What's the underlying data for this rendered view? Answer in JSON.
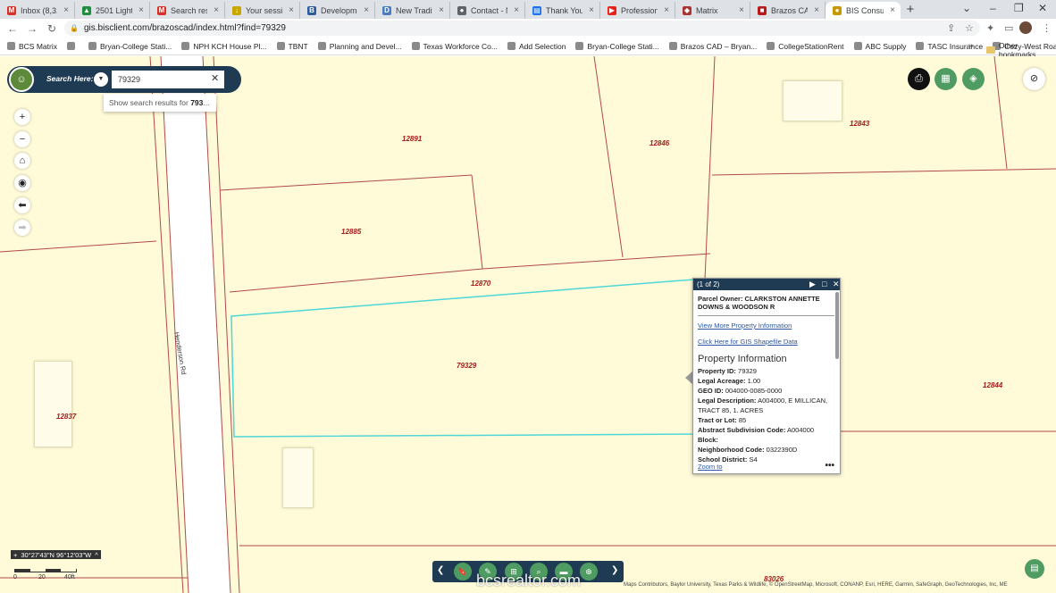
{
  "browser": {
    "tabs": [
      {
        "label": "Inbox (8,310)",
        "icon": "gmail-icon",
        "color": "#d93025",
        "glyph": "M"
      },
      {
        "label": "2501 Lightfoo",
        "icon": "drive-icon",
        "color": "#1e8e3e",
        "glyph": "▲"
      },
      {
        "label": "Search results",
        "icon": "gmail-icon",
        "color": "#d93025",
        "glyph": "M"
      },
      {
        "label": "Your session",
        "icon": "download-icon",
        "color": "#c9a600",
        "glyph": "↓"
      },
      {
        "label": "Development",
        "icon": "b-icon",
        "color": "#2d5a9b",
        "glyph": "B"
      },
      {
        "label": "New Traditio",
        "icon": "doc-icon",
        "color": "#4a7bc0",
        "glyph": "D"
      },
      {
        "label": "Contact - Ne",
        "icon": "globe-icon",
        "color": "#5f6368",
        "glyph": "●"
      },
      {
        "label": "Thank You! Y",
        "icon": "chart-icon",
        "color": "#1a73e8",
        "glyph": "▤"
      },
      {
        "label": "Professional",
        "icon": "youtube-icon",
        "color": "#e62117",
        "glyph": "▶"
      },
      {
        "label": "Matrix",
        "icon": "matrix-icon",
        "color": "#a33",
        "glyph": "◆"
      },
      {
        "label": "Brazos CAD",
        "icon": "cad-icon",
        "color": "#b71c1c",
        "glyph": "■"
      },
      {
        "label": "BIS Consultin",
        "icon": "bis-icon",
        "color": "#c99700",
        "glyph": "●"
      }
    ],
    "close_glyph": "×",
    "newtab_glyph": "+",
    "window_controls": [
      "⌄",
      "–",
      "❐",
      "✕"
    ],
    "nav": {
      "back": "←",
      "forward": "→",
      "reload": "↻"
    },
    "lock_glyph": "🔒",
    "url": "gis.bisclient.com/brazoscad/index.html?find=79329",
    "toolbar_icons": [
      "⇪",
      "☆",
      "✦",
      "▭",
      "⋮"
    ],
    "bookmarks": [
      "BCS Matrix",
      "",
      "Bryan-College Stati...",
      "NPH KCH House Pl...",
      "TBNT",
      "Planning and Devel...",
      "Texas Workforce Co...",
      "Add Selection",
      "Bryan-College Stati...",
      "Brazos CAD – Bryan...",
      "CollegeStationRent",
      "ABC Supply",
      "TASC Insurance",
      "Cozy-West Road W..."
    ],
    "bookmarks_more": "»",
    "other_bookmarks": "Other bookmarks"
  },
  "search": {
    "label": "Search Here:",
    "value": "79329",
    "suggestion_prefix": "Show search results for ",
    "suggestion_bold": "793",
    "suggestion_suffix": "..."
  },
  "left_tools": [
    {
      "name": "zoom-in-button",
      "glyph": "+"
    },
    {
      "name": "zoom-out-button",
      "glyph": "−"
    },
    {
      "name": "home-button",
      "glyph": "⌂"
    },
    {
      "name": "locate-button",
      "glyph": "◉"
    },
    {
      "name": "back-extent-button",
      "glyph": "⬅"
    },
    {
      "name": "forward-extent-button",
      "glyph": "➡"
    }
  ],
  "right_tools": [
    {
      "name": "print-button",
      "glyph": "⎙"
    },
    {
      "name": "basemap-gallery-button",
      "glyph": "▦"
    },
    {
      "name": "layers-button",
      "glyph": "◈"
    },
    {
      "name": "hide-panel-button",
      "glyph": "⊘"
    }
  ],
  "parcels": [
    "12891",
    "12846",
    "12843",
    "12885",
    "12870",
    "79329",
    "12844",
    "12837",
    "83026"
  ],
  "road_label": "Henderson Rd",
  "popup": {
    "counter": "(1 of 2)",
    "next": "▶",
    "maximize": "□",
    "close": "✕",
    "owner": "Parcel Owner: CLARKSTON ANNETTE DOWNS & WOODSON R",
    "link1": "View More Property Information",
    "link2": "Click Here for GIS Shapefile Data",
    "section_title": "Property Information",
    "fields": [
      {
        "k": "Property ID:",
        "v": " 79329"
      },
      {
        "k": "Legal Acreage:",
        "v": " 1.00"
      },
      {
        "k": "GEO ID:",
        "v": " 004000-0085-0000"
      },
      {
        "k": "Legal Description:",
        "v": " A004000, E MILLICAN, TRACT 85, 1. ACRES"
      },
      {
        "k": "Tract or Lot:",
        "v": " 85"
      },
      {
        "k": "Abstract Subdivision Code:",
        "v": " A004000"
      },
      {
        "k": "Block:",
        "v": ""
      },
      {
        "k": "Neighborhood Code:",
        "v": " 0322390D"
      },
      {
        "k": "School District:",
        "v": " S4"
      },
      {
        "k": "City Limits:",
        "v": ""
      }
    ],
    "zoom_to": "Zoom to",
    "more": "•••"
  },
  "coordinates": "30°27'43\"N 96°12'03\"W",
  "coord_glyph_left": "+",
  "coord_glyph_right": "^",
  "scale_ticks": [
    "0",
    "20",
    "40ft"
  ],
  "bottom_tools": [
    {
      "name": "bookmark-tool",
      "glyph": "🔖"
    },
    {
      "name": "draw-tool",
      "glyph": "✎"
    },
    {
      "name": "measure-tool",
      "glyph": "⊞"
    },
    {
      "name": "query-tool",
      "glyph": "⌕"
    },
    {
      "name": "table-tool",
      "glyph": "▬"
    },
    {
      "name": "add-data-tool",
      "glyph": "⊕"
    }
  ],
  "bottom_prev": "❮",
  "bottom_next": "❯",
  "attribution": "Maps Contributors, Baylor University, Texas Parks & Wildlife, © OpenStreetMap, Microsoft, CONANP, Esri, HERE, Garmin, SafeGraph, GeoTechnologies, Inc, ME",
  "watermark": "bcsrealtor.com",
  "legend_glyph": "▤",
  "colors": {
    "accent": "#4f9c62",
    "panel": "#1f3b53",
    "parcel_label": "#a31b1b",
    "highlight": "#4fd6d6",
    "map_bg": "#fffbd8"
  }
}
